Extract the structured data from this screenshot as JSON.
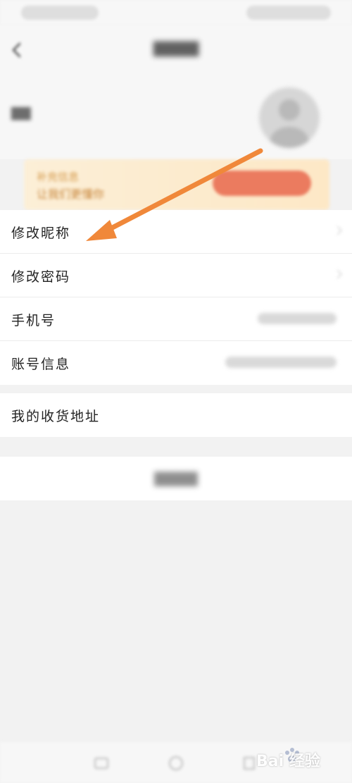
{
  "header": {
    "back_icon": "back-chevron-icon"
  },
  "promo": {
    "line1": "补充信息",
    "line2": "让我们更懂你"
  },
  "settings": {
    "items": [
      {
        "label": "修改昵称",
        "icon": "chevron-right-icon"
      },
      {
        "label": "修改密码",
        "icon": "chevron-right-icon"
      },
      {
        "label": "手机号"
      },
      {
        "label": "账号信息"
      }
    ]
  },
  "address": {
    "label": "我的收货地址"
  },
  "annotation": {
    "color": "#f0883a",
    "target": "修改昵称"
  },
  "colors": {
    "background": "#f2f2f2",
    "card": "#ffffff",
    "promo_bg": "#fdebd0",
    "promo_text": "#c7853a",
    "promo_button": "#eb7b5f"
  },
  "watermark": {
    "text": "Bai 经验"
  }
}
